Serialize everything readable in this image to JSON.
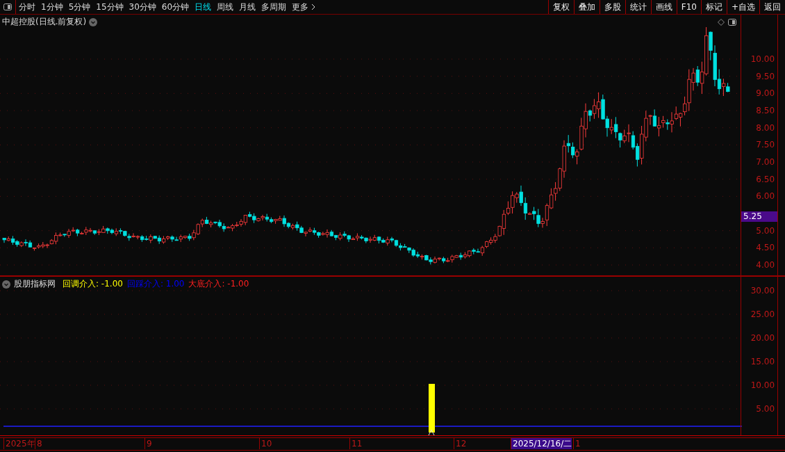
{
  "toolbar": {
    "periods": [
      {
        "label": "分时",
        "selected": false
      },
      {
        "label": "1分钟",
        "selected": false
      },
      {
        "label": "5分钟",
        "selected": false
      },
      {
        "label": "15分钟",
        "selected": false
      },
      {
        "label": "30分钟",
        "selected": false
      },
      {
        "label": "60分钟",
        "selected": false
      },
      {
        "label": "日线",
        "selected": true
      },
      {
        "label": "周线",
        "selected": false
      },
      {
        "label": "月线",
        "selected": false
      },
      {
        "label": "多周期",
        "selected": false
      }
    ],
    "more": "更多",
    "actions": [
      "复权",
      "叠加",
      "多股",
      "统计",
      "画线",
      "F10",
      "标记",
      "+自选",
      "返回"
    ]
  },
  "chart": {
    "title": "中超控股(日线.前复权)",
    "price_ticks": [
      "10.00",
      "9.50",
      "9.00",
      "8.50",
      "8.00",
      "7.50",
      "7.00",
      "6.50",
      "6.00",
      "5.00",
      "4.50",
      "4.00"
    ],
    "current_price": "5.25"
  },
  "indicator": {
    "title": "股朋指标网",
    "legend": [
      {
        "text": "回调介入: -1.00",
        "color": "#ffff00"
      },
      {
        "text": "回踩介入: 1.00",
        "color": "#0000ff"
      },
      {
        "text": "大底介入: -1.00",
        "color": "#ff2020"
      }
    ],
    "ticks": [
      "30.00",
      "25.00",
      "20.00",
      "15.00",
      "10.00",
      "5.00"
    ]
  },
  "time_axis": {
    "labels": [
      {
        "text": "2025年",
        "selected": false
      },
      {
        "text": "8",
        "selected": false
      },
      {
        "text": "9",
        "selected": false
      },
      {
        "text": "10",
        "selected": false
      },
      {
        "text": "11",
        "selected": false
      },
      {
        "text": "12",
        "selected": false
      },
      {
        "text": "2025/12/16/二",
        "selected": true
      },
      {
        "text": "1",
        "selected": false
      }
    ]
  }
}
